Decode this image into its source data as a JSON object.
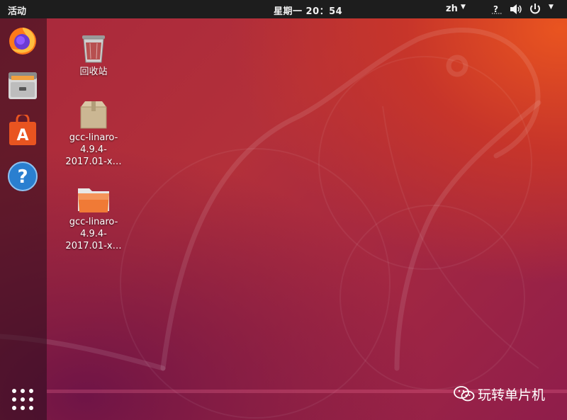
{
  "topbar": {
    "activities": "活动",
    "clock": "星期一 20：54",
    "language": "zh",
    "tray_icons": [
      "accessibility-icon",
      "volume-icon",
      "power-icon"
    ]
  },
  "dock": {
    "apps": [
      "firefox-icon",
      "files-icon",
      "software-center-icon",
      "help-icon"
    ],
    "show_apps": "show-applications-icon"
  },
  "desktop": {
    "icons": [
      {
        "label": "回收站",
        "icon": "trash-icon"
      },
      {
        "label_lines": [
          "gcc-linaro-",
          "4.9.4-",
          "2017.01-x…"
        ],
        "icon": "archive-package-icon"
      },
      {
        "label_lines": [
          "gcc-linaro-",
          "4.9.4-",
          "2017.01-x…"
        ],
        "icon": "folder-icon"
      }
    ]
  },
  "watermark": {
    "text": "玩转单片机",
    "icon": "wechat-icon"
  },
  "colors": {
    "accent": "#e95420",
    "topbar": "#1d1d1d",
    "wallpaper": "#a8283c"
  }
}
